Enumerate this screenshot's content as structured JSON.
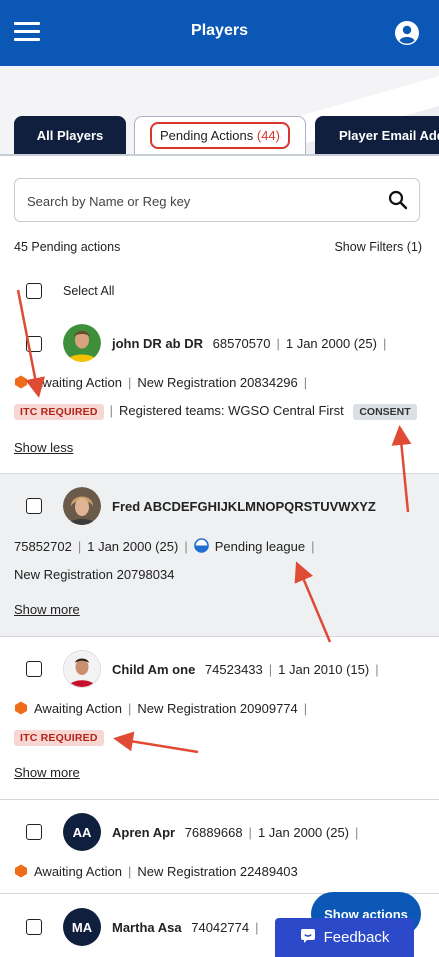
{
  "header": {
    "title": "Players",
    "menu_icon": "hamburger-icon",
    "account_icon": "account-circle-icon"
  },
  "tabs": [
    {
      "label": "All Players"
    },
    {
      "label": "Pending Actions",
      "count": "(44)"
    },
    {
      "label": "Player Email Addr"
    }
  ],
  "search": {
    "placeholder": "Search by Name or Reg key"
  },
  "summary": {
    "count_label": "45 Pending actions",
    "filters_label": "Show Filters (1)"
  },
  "select_all": "Select All",
  "players": [
    {
      "name": "john DR ab DR",
      "reg": "68570570",
      "dob": "1 Jan 2000 (25)",
      "status": "Awaiting Action",
      "action": "New Registration 20834296",
      "badge": "ITC REQUIRED",
      "teams": "Registered teams: WGSO Central First",
      "consent": "CONSENT",
      "toggle": "Show less"
    },
    {
      "name": "Fred ABCDEFGHIJKLMNOPQRSTUVWXYZ",
      "reg": "75852702",
      "dob": "1 Jan 2000 (25)",
      "status": "Pending league",
      "action": "New Registration 20798034",
      "toggle": "Show more"
    },
    {
      "name": "Child Am one",
      "reg": "74523433",
      "dob": "1 Jan 2010 (15)",
      "status": "Awaiting Action",
      "action": "New Registration 20909774",
      "badge": "ITC REQUIRED",
      "toggle": "Show more"
    },
    {
      "name": "Apren Apr",
      "reg": "76889668",
      "dob": "1 Jan 2000 (25)",
      "initials": "AA",
      "status": "Awaiting Action",
      "action": "New Registration 22489403"
    },
    {
      "name": "Martha Asa",
      "reg": "74042774",
      "initials": "MA"
    }
  ],
  "fab": {
    "label": "Show actions"
  },
  "feedback": {
    "label": "Feedback"
  },
  "colors": {
    "brand": "#0a57b5",
    "navy": "#0f1f3d",
    "alert": "#d9362b",
    "awaiting": "#ef6c1a",
    "feedback": "#2c49c9"
  }
}
